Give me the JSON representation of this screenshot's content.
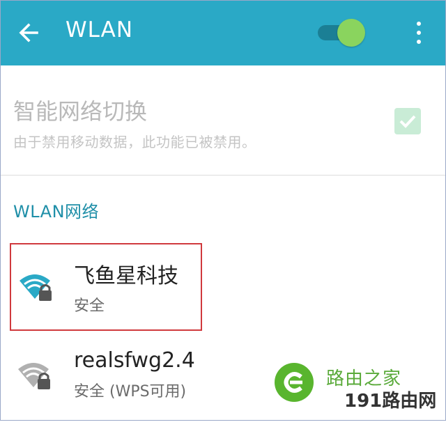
{
  "appbar": {
    "title": "WLAN",
    "wlan_enabled": true,
    "accent": "#2aa9c6",
    "toggle_on_color": "#8ad45e"
  },
  "smart_switch": {
    "title": "智能网络切换",
    "subtitle": "由于禁用移动数据，此功能已被禁用。",
    "checked": true,
    "disabled": true
  },
  "networks_section": {
    "header": "WLAN网络",
    "items": [
      {
        "name": "飞鱼星科技",
        "status": "安全",
        "secured": true,
        "icon": "wifi-lock-icon",
        "signal_color": "#2aa9c6",
        "selected": true
      },
      {
        "name": "realsfwg2.4",
        "status": "安全 (WPS可用)",
        "secured": true,
        "icon": "wifi-lock-icon",
        "signal_color": "#b0b0b0",
        "selected": false
      }
    ]
  },
  "watermark": {
    "line1": "路由之家",
    "line2": "191路由网"
  },
  "icons": {
    "back": "back-arrow-icon",
    "more": "more-vert-icon",
    "check": "check-icon"
  }
}
